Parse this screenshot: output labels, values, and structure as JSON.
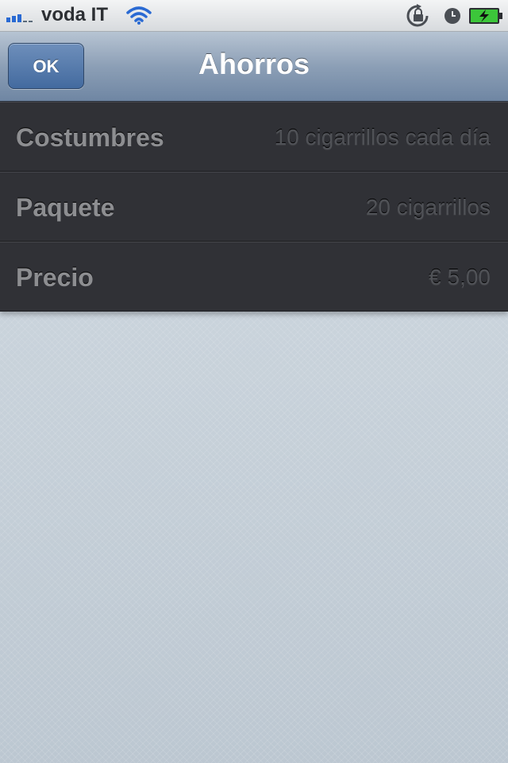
{
  "status_bar": {
    "carrier": "voda IT",
    "signal_bars_filled": 3,
    "signal_bars_total": 5,
    "icons": [
      "signal-icon",
      "wifi-icon",
      "lock-rotation-icon",
      "clock-icon",
      "battery-charging-icon"
    ],
    "battery_color": "#3cc63a"
  },
  "nav": {
    "ok_label": "OK",
    "title": "Ahorros",
    "accent": "#4b6fa3"
  },
  "settings": [
    {
      "label": "Costumbres",
      "value": "10 cigarrillos cada día"
    },
    {
      "label": "Paquete",
      "value": "20 cigarrillos"
    },
    {
      "label": "Precio",
      "value": "€ 5,00"
    }
  ]
}
